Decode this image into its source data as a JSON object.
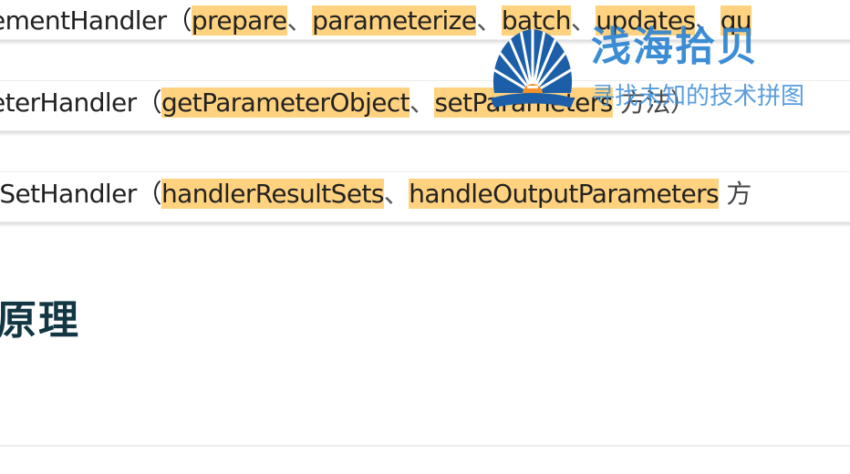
{
  "rows": [
    {
      "prefix": "ementHandler（",
      "m1": "prepare",
      "s1": "、",
      "m2": "parameterize",
      "s2": "、",
      "m3": "batch",
      "s3": "、",
      "m4": "updates",
      "s4": "、",
      "m5": "qu"
    },
    {
      "prefix": "eterHandler（",
      "m1": "getParameterObject",
      "s1": "、",
      "m2": "setParameters",
      "suffix": " 方法）"
    },
    {
      "prefix": "tSetHandler（",
      "m1": "handlerResultSets",
      "s1": "、",
      "m2": "handleOutputParameters",
      "suffix": " 方"
    }
  ],
  "heading": "原理",
  "watermark": {
    "title": "浅海拾贝",
    "subtitle": "寻找未知的技术拼图",
    "icon": "seashell-logo-icon"
  },
  "colors": {
    "highlight": "#ffd27f",
    "heading": "#123743",
    "watermark": "#2d84d2"
  }
}
